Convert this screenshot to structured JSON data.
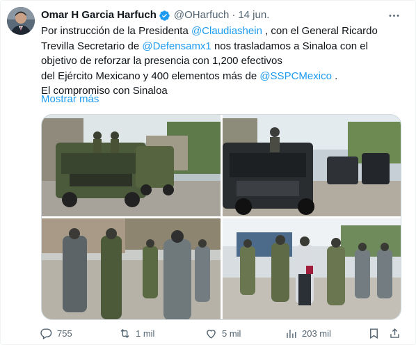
{
  "author": {
    "name": "Omar H Garcia Harfuch",
    "handle": "@OHarfuch",
    "separator": "·",
    "date": "14 jun."
  },
  "tweet": {
    "lines": [
      [
        {
          "t": "Por instrucción de la Presidenta ",
          "m": false
        },
        {
          "t": "@Claudiashein",
          "m": true
        },
        {
          "t": " , con el General Ricardo",
          "m": false
        }
      ],
      [
        {
          "t": "Trevilla Secretario de ",
          "m": false
        },
        {
          "t": "@Defensamx1",
          "m": true
        },
        {
          "t": " nos trasladamos a Sinaloa con el",
          "m": false
        }
      ],
      [
        {
          "t": "objetivo de reforzar la presencia con 1,200 efectivos",
          "m": false
        }
      ],
      [
        {
          "t": "del Ejército Mexicano y 400 elementos más de ",
          "m": false
        },
        {
          "t": "@SSPCMexico",
          "m": true
        },
        {
          "t": " .",
          "m": false
        }
      ],
      [
        {
          "t": "El compromiso con Sinaloa",
          "m": false
        }
      ]
    ],
    "show_more": "Mostrar más"
  },
  "stats": {
    "replies": "755",
    "retweets": "1 mil",
    "likes": "5 mil",
    "views": "203 mil"
  },
  "colors": {
    "accent": "#1d9bf0",
    "text": "#0f1419",
    "muted": "#536471",
    "border": "#cfd9de"
  },
  "icons": {
    "verified": "verified-badge-icon",
    "more": "more-options-icon",
    "reply": "reply-icon",
    "retweet": "retweet-icon",
    "like": "heart-icon",
    "views": "views-chart-icon",
    "bookmark": "bookmark-icon",
    "share": "share-icon"
  }
}
